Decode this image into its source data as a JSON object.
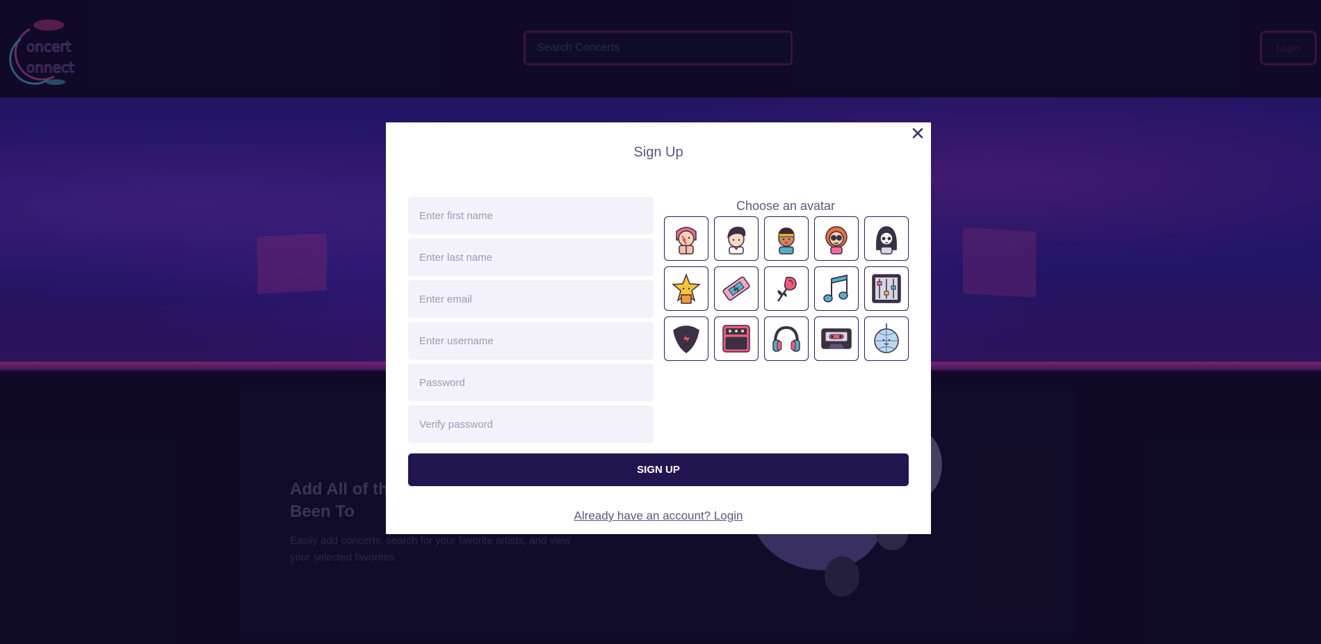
{
  "header": {
    "logo_text": "concert connect",
    "search_placeholder": "Search Concerts",
    "login_label": "Login"
  },
  "feature": {
    "title": "Add All of the Concerts You've Been To",
    "description": "Easily add concerts, search for your favorite artists, and view your selected favorites."
  },
  "modal": {
    "title": "Sign Up",
    "close_symbol": "✕",
    "fields": {
      "first_name_placeholder": "Enter first name",
      "last_name_placeholder": "Enter last name",
      "email_placeholder": "Enter email",
      "username_placeholder": "Enter username",
      "password_placeholder": "Password",
      "verify_password_placeholder": "Verify password"
    },
    "avatar_label": "Choose an avatar",
    "avatars": [
      {
        "icon": "glam-rocker-avatar-icon"
      },
      {
        "icon": "pompadour-singer-avatar-icon"
      },
      {
        "icon": "headband-singer-avatar-icon"
      },
      {
        "icon": "sunglasses-rocker-avatar-icon"
      },
      {
        "icon": "long-hair-rocker-avatar-icon"
      },
      {
        "icon": "star-icon"
      },
      {
        "icon": "ticket-icon"
      },
      {
        "icon": "rose-icon"
      },
      {
        "icon": "music-note-icon"
      },
      {
        "icon": "mixer-icon"
      },
      {
        "icon": "guitar-pick-icon"
      },
      {
        "icon": "amplifier-icon"
      },
      {
        "icon": "headphones-icon"
      },
      {
        "icon": "cassette-icon"
      },
      {
        "icon": "disco-ball-icon"
      }
    ],
    "signup_label": "SIGN UP",
    "login_link": "Already have an account? Login"
  },
  "colors": {
    "modal_bg": "#ffffff",
    "primary_button": "#231650",
    "page_bg": "#120c2c",
    "hero": "#2d1a7e"
  }
}
